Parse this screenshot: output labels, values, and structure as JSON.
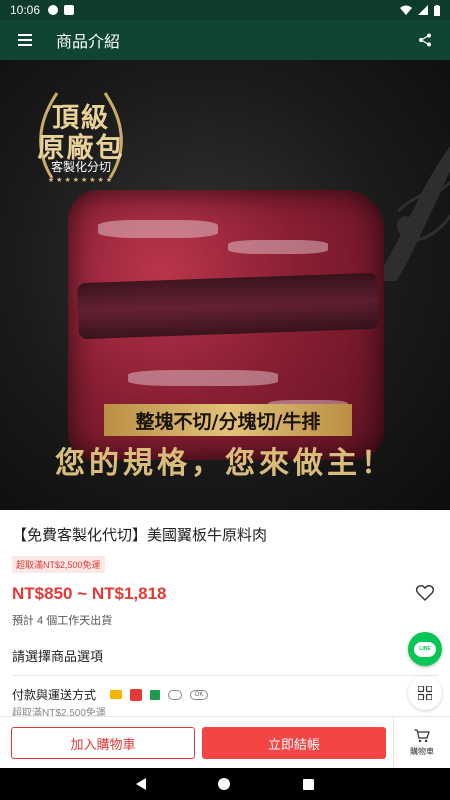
{
  "status_bar": {
    "time": "10:06"
  },
  "app_bar": {
    "title": "商品介紹",
    "menu_icon": "hamburger-menu-icon",
    "share_icon": "share-icon"
  },
  "hero": {
    "badge_line1": "頂級",
    "badge_line2": "原廠包",
    "badge_line3": "客製化分切",
    "badge_stars": "★★★★★★★★",
    "spec_banner": "整塊不切/分塊切/牛排",
    "slogan": "您的規格，您來做主！"
  },
  "product": {
    "title": "【免費客製化代切】美國翼板牛原料肉",
    "shipping_tag": "超取滿NT$2,500免運",
    "price": "NT$850 ~ NT$1,818",
    "ship_note": "預計 4 個工作天出貨"
  },
  "options": {
    "label": "請選擇商品選項"
  },
  "payment": {
    "label": "付款與運送方式",
    "sub": "超取滿NT$2,500免運",
    "ok_label": "OK"
  },
  "line_button": {
    "label": "LINE"
  },
  "bottom_bar": {
    "add_to_cart": "加入購物車",
    "checkout": "立即結帳",
    "cart": "購物車"
  },
  "colors": {
    "app_bar": "#0f4535",
    "accent_red": "#f44545",
    "price_red": "#e53935",
    "line_green": "#06c755"
  }
}
